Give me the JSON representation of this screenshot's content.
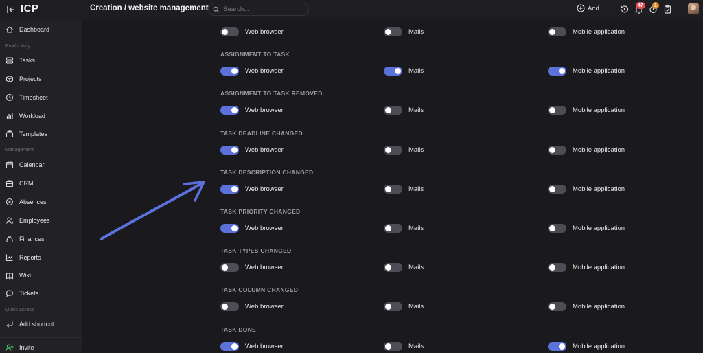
{
  "header": {
    "logo": "ICP",
    "title": "Creation / website management",
    "search_placeholder": "Search...",
    "add_label": "Add",
    "notifications_count": "47",
    "alerts_count": "1"
  },
  "sidebar": {
    "dashboard": "Dashboard",
    "section_productivity": "Productivity",
    "tasks": "Tasks",
    "projects": "Projects",
    "timesheet": "Timesheet",
    "workload": "Workload",
    "templates": "Templates",
    "section_management": "Management",
    "calendar": "Calendar",
    "crm": "CRM",
    "absences": "Absences",
    "employees": "Employees",
    "finances": "Finances",
    "reports": "Reports",
    "wiki": "Wiki",
    "tickets": "Tickets",
    "section_quick_access": "Quick access",
    "add_shortcut": "Add shortcut",
    "invite": "Invite"
  },
  "labels": {
    "web": "Web browser",
    "mail": "Mails",
    "mobile": "Mobile application"
  },
  "groups": [
    {
      "title": "",
      "web": false,
      "mail": false,
      "mobile": false
    },
    {
      "title": "ASSIGNMENT TO TASK",
      "web": true,
      "mail": true,
      "mobile": true
    },
    {
      "title": "ASSIGNMENT TO TASK REMOVED",
      "web": true,
      "mail": false,
      "mobile": false
    },
    {
      "title": "TASK DEADLINE CHANGED",
      "web": true,
      "mail": false,
      "mobile": false
    },
    {
      "title": "TASK DESCRIPTION CHANGED",
      "web": true,
      "mail": false,
      "mobile": false
    },
    {
      "title": "TASK PRIORITY CHANGED",
      "web": true,
      "mail": false,
      "mobile": false
    },
    {
      "title": "TASK TYPES CHANGED",
      "web": false,
      "mail": false,
      "mobile": false
    },
    {
      "title": "TASK COLUMN CHANGED",
      "web": false,
      "mail": false,
      "mobile": false
    },
    {
      "title": "TASK DONE",
      "web": true,
      "mail": false,
      "mobile": true
    }
  ],
  "colors": {
    "toggle_on": "#5b72db",
    "toggle_off": "#4d4d55",
    "annotation_arrow": "#5b72db",
    "badge_notifications": "#e5484d",
    "badge_alerts": "#e08a2c"
  }
}
